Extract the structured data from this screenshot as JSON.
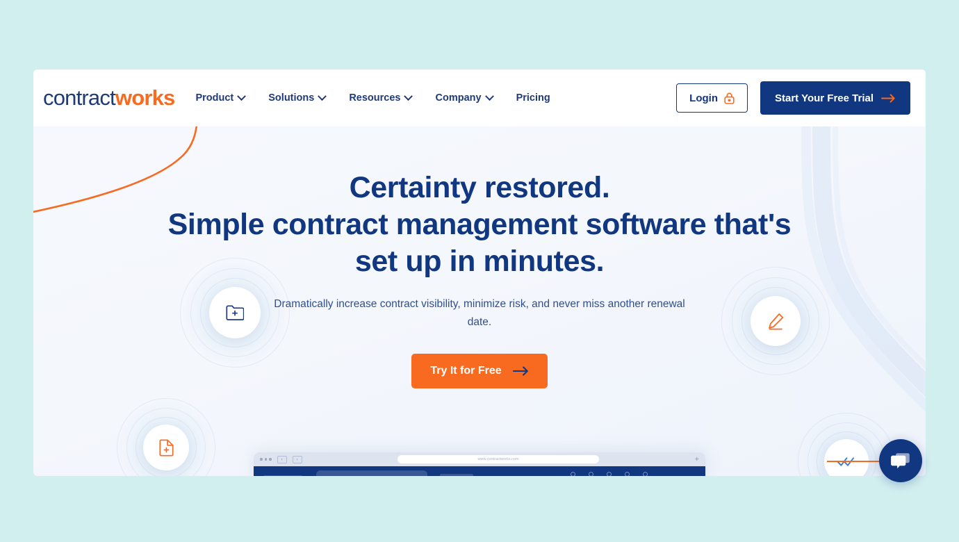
{
  "brand": {
    "logo_primary": "contract",
    "logo_accent": "works",
    "navy": "#10377f",
    "orange": "#f96a21",
    "page_background": "#d2eff0",
    "hero_background": "#f5f7fc"
  },
  "nav": {
    "items": [
      {
        "label": "Product",
        "has_dropdown": true
      },
      {
        "label": "Solutions",
        "has_dropdown": true
      },
      {
        "label": "Resources",
        "has_dropdown": true
      },
      {
        "label": "Company",
        "has_dropdown": true
      },
      {
        "label": "Pricing",
        "has_dropdown": false
      }
    ],
    "login_label": "Login",
    "trial_label": "Start Your Free Trial"
  },
  "hero": {
    "headline_line1": "Certainty restored.",
    "headline_line2": "Simple contract management software that's",
    "headline_line3": "set up in minutes.",
    "subheadline": "Dramatically increase contract visibility, minimize risk, and never miss another renewal date.",
    "cta_label": "Try It for Free",
    "badges": [
      {
        "name": "folder-add-icon",
        "color": "#1f3a7a"
      },
      {
        "name": "pencil-edit-icon",
        "color": "#f96a21"
      },
      {
        "name": "document-add-icon",
        "color": "#f96a21"
      },
      {
        "name": "checkmarks-icon",
        "color": "#3f7fd0"
      }
    ]
  },
  "browser_mock": {
    "url": "www.contractworks.com",
    "new_tab_label": "+"
  },
  "chat": {
    "tooltip": "Chat"
  }
}
